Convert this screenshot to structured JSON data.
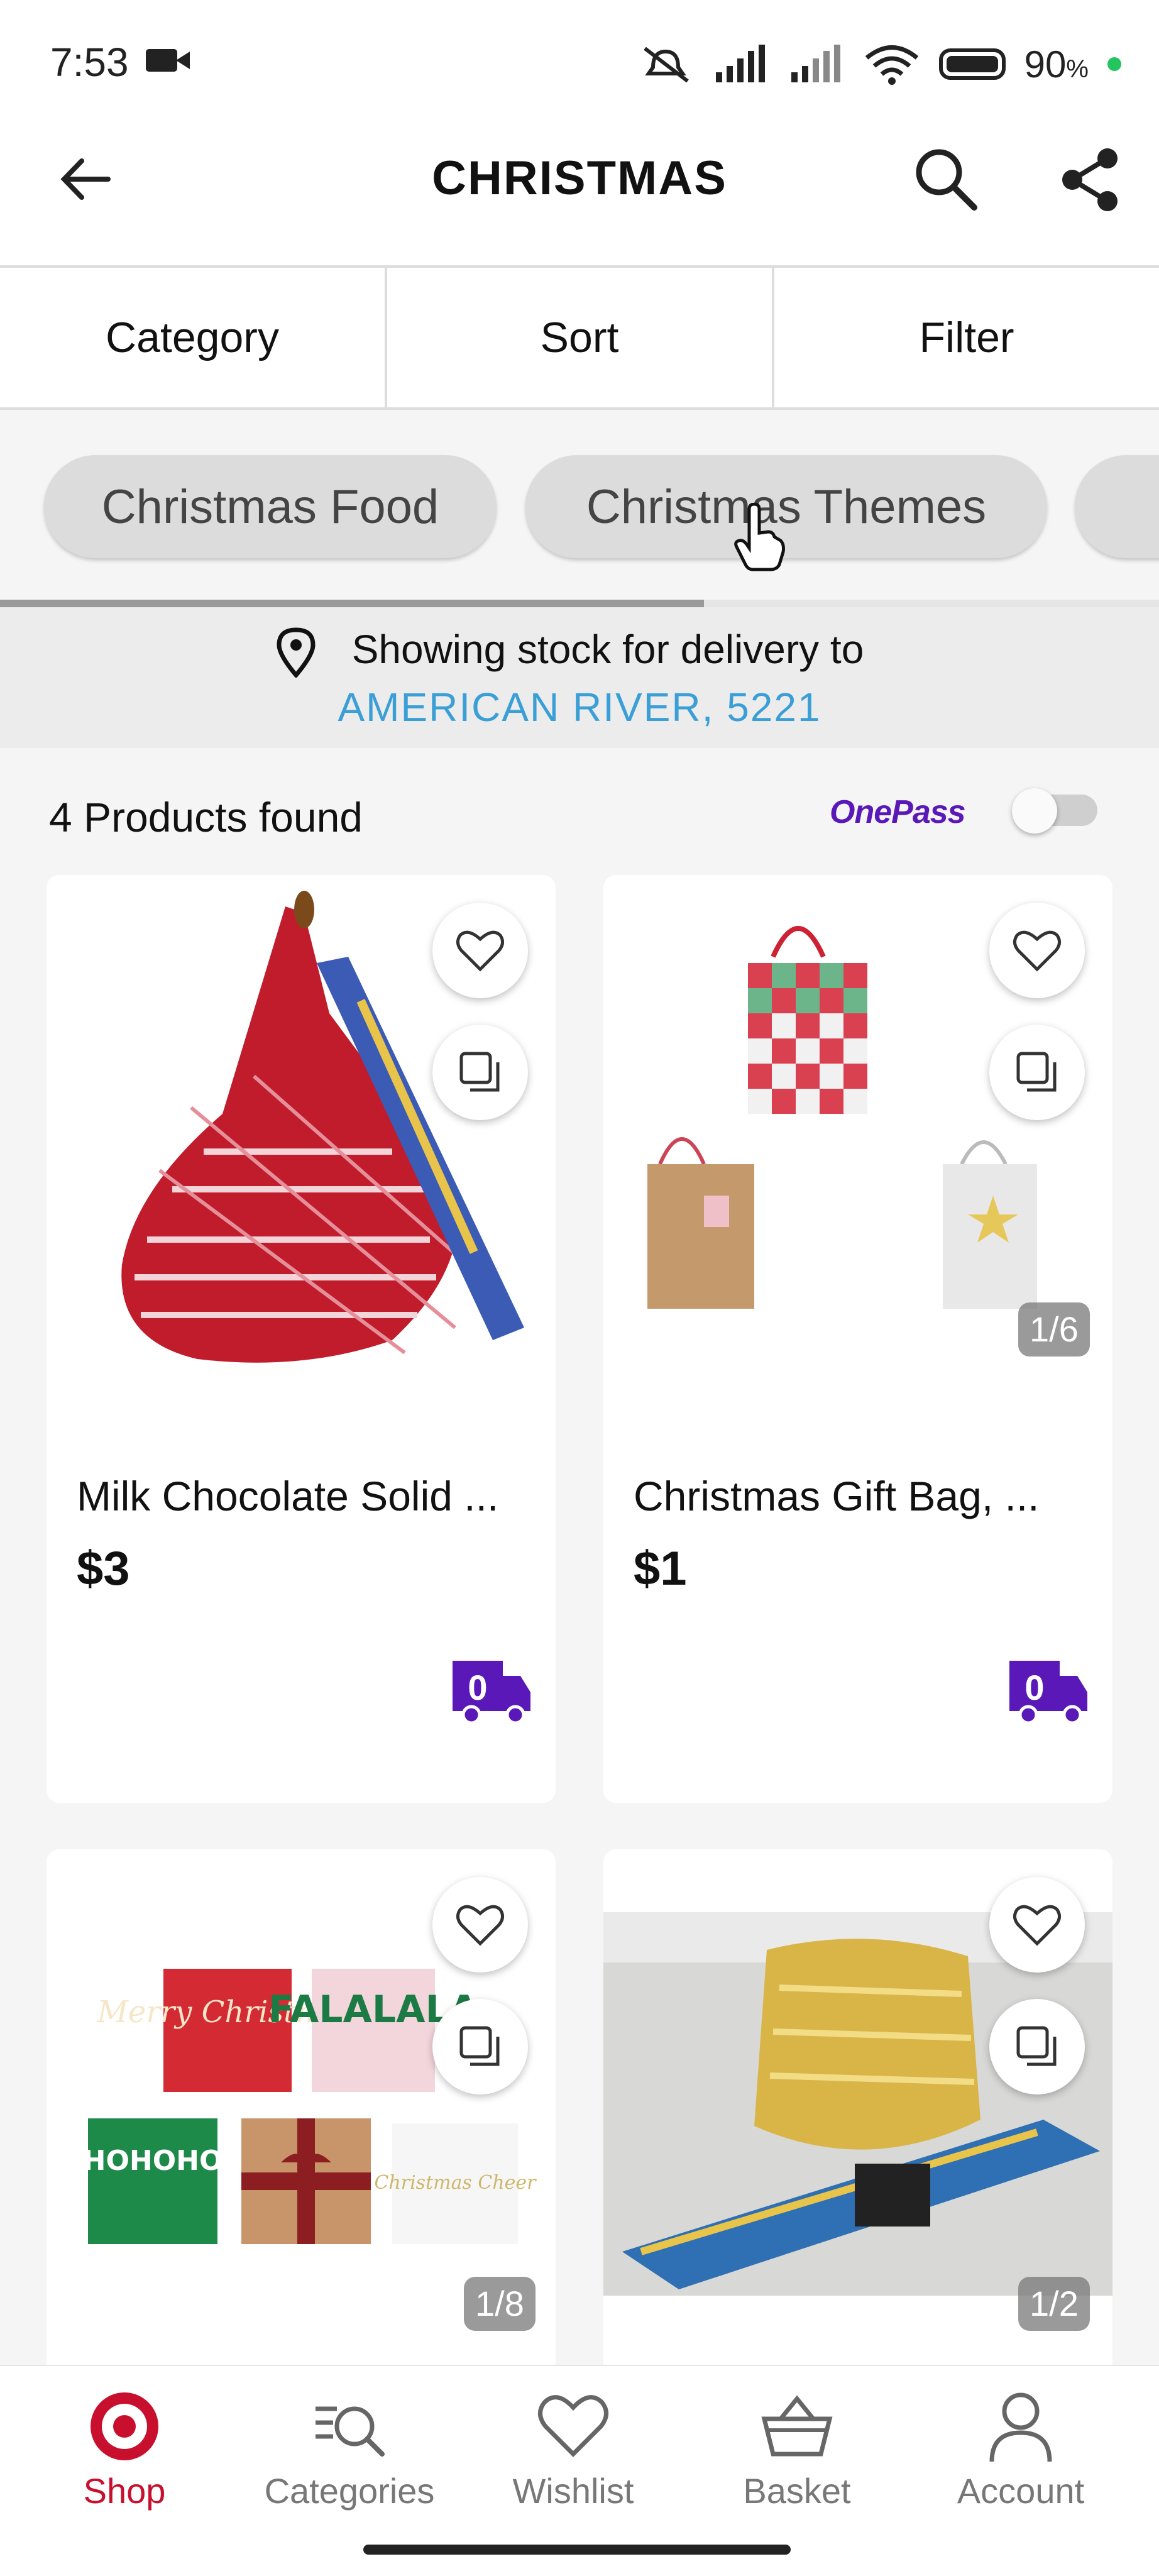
{
  "status_bar": {
    "time": "7:53",
    "battery": "90",
    "battery_unit": "%"
  },
  "header": {
    "title": "CHRISTMAS"
  },
  "tabs": [
    {
      "label": "Category"
    },
    {
      "label": "Sort"
    },
    {
      "label": "Filter"
    }
  ],
  "chips": [
    {
      "label": "Christmas Food"
    },
    {
      "label": "Christmas Themes"
    }
  ],
  "delivery": {
    "line1": "Showing stock for delivery to",
    "location": "AMERICAN RIVER, 5221"
  },
  "results": {
    "count_text": "4 Products found",
    "onepass_label": "OnePass",
    "onepass_toggle_on": false
  },
  "products": [
    {
      "title": "Milk Chocolate Solid ...",
      "price": "$3",
      "image": "chocolate-net-bag"
    },
    {
      "title": "Christmas Gift Bag, ...",
      "price": "$1",
      "image": "gift-bags",
      "counter": "1/6"
    },
    {
      "title": "",
      "price": "",
      "image": "gift-cards",
      "counter": "1/8",
      "card_texts": [
        "Merry Christmas",
        "FALALALA",
        "HOHOHO",
        "Christmas Cheer"
      ]
    },
    {
      "title": "",
      "price": "",
      "image": "gold-chocolate-coins",
      "counter": "1/2"
    }
  ],
  "bottom_nav": [
    {
      "label": "Shop",
      "icon": "target-logo-icon",
      "active": true
    },
    {
      "label": "Categories",
      "icon": "categories-search-icon",
      "active": false
    },
    {
      "label": "Wishlist",
      "icon": "heart-icon",
      "active": false
    },
    {
      "label": "Basket",
      "icon": "basket-icon",
      "active": false
    },
    {
      "label": "Account",
      "icon": "account-icon",
      "active": false
    }
  ],
  "colors": {
    "brand_red": "#c8102e",
    "link_blue": "#3a9fd6",
    "onepass_purple": "#5a18b8"
  }
}
